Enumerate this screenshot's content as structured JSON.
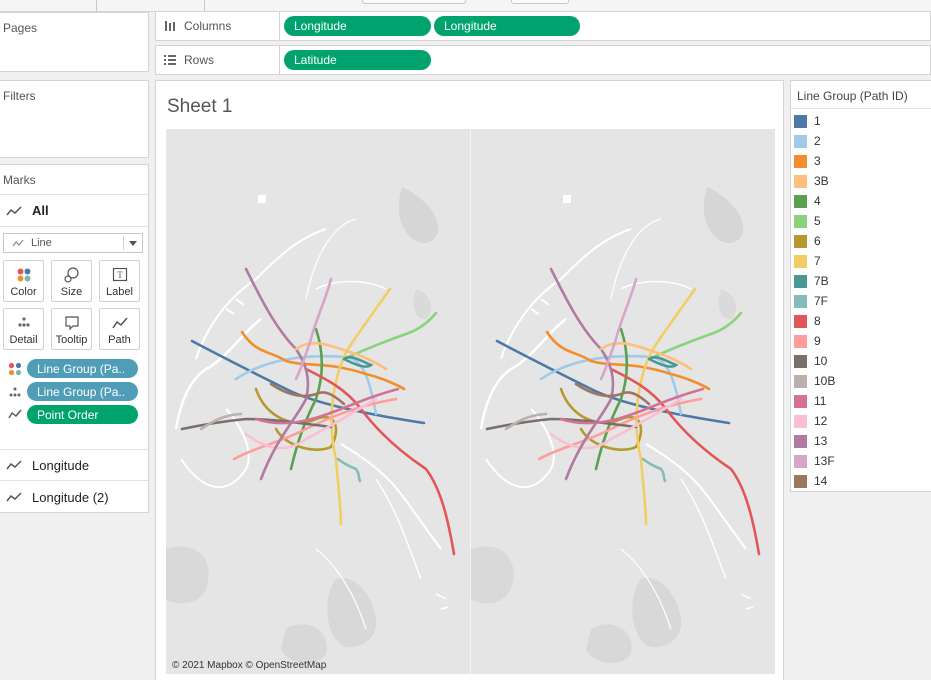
{
  "shelves": {
    "pages_label": "Pages",
    "filters_label": "Filters",
    "columns_label": "Columns",
    "rows_label": "Rows",
    "columns_pills": [
      "Longitude",
      "Longitude"
    ],
    "rows_pills": [
      "Latitude"
    ]
  },
  "marks": {
    "title": "Marks",
    "all_label": "All",
    "mark_type": "Line",
    "buttons": {
      "color": "Color",
      "size": "Size",
      "label": "Label",
      "detail": "Detail",
      "tooltip": "Tooltip",
      "path": "Path"
    },
    "fields": [
      {
        "label": "Line Group (Pa..",
        "icon": "color-dots-icon",
        "color": "#4f9db7"
      },
      {
        "label": "Line Group (Pa..",
        "icon": "detail-dots-icon",
        "color": "#4f9db7"
      },
      {
        "label": "Point Order",
        "icon": "path-line-icon",
        "color": "#00a36e"
      }
    ],
    "cards": [
      "Longitude",
      "Longitude (2)"
    ]
  },
  "sheet": {
    "title": "Sheet 1",
    "attribution": "© 2021 Mapbox © OpenStreetMap"
  },
  "legend": {
    "title": "Line Group (Path ID)",
    "items": [
      {
        "label": "1",
        "color": "#4e79a7"
      },
      {
        "label": "2",
        "color": "#a0cbe8"
      },
      {
        "label": "3",
        "color": "#f28e2b"
      },
      {
        "label": "3B",
        "color": "#ffbe7d"
      },
      {
        "label": "4",
        "color": "#59a14f"
      },
      {
        "label": "5",
        "color": "#8cd17d"
      },
      {
        "label": "6",
        "color": "#b6992d"
      },
      {
        "label": "7",
        "color": "#f1ce63"
      },
      {
        "label": "7B",
        "color": "#499894"
      },
      {
        "label": "7F",
        "color": "#86bcb6"
      },
      {
        "label": "8",
        "color": "#e15759"
      },
      {
        "label": "9",
        "color": "#ff9d9a"
      },
      {
        "label": "10",
        "color": "#79706e"
      },
      {
        "label": "10B",
        "color": "#bab0ac"
      },
      {
        "label": "11",
        "color": "#d37295"
      },
      {
        "label": "12",
        "color": "#fabfd2"
      },
      {
        "label": "13",
        "color": "#b07aa1"
      },
      {
        "label": "13F",
        "color": "#d4a6c8"
      },
      {
        "label": "14",
        "color": "#9d7660"
      }
    ]
  }
}
